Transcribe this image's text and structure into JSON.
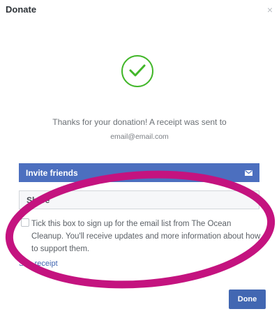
{
  "dialog": {
    "title": "Donate",
    "close_icon": "×"
  },
  "confirmation": {
    "check_icon": "check-circle-icon",
    "accent_color": "#42b72a",
    "message": "Thanks for your donation! A receipt was sent to",
    "email": "email@email.com"
  },
  "actions": {
    "invite_label": "Invite friends",
    "invite_icon": "envelope-icon",
    "invite_color": "#4c6fbf",
    "share_label": "Share"
  },
  "signup": {
    "checked": false,
    "text": "Tick this box to sign up for the email list from The Ocean Cleanup. You'll receive updates and more information about how to support them."
  },
  "receipt_link": "See receipt",
  "footer": {
    "done_label": "Done",
    "done_color": "#4267b2"
  },
  "annotation": {
    "shape": "ellipse",
    "color": "#c4137f"
  }
}
